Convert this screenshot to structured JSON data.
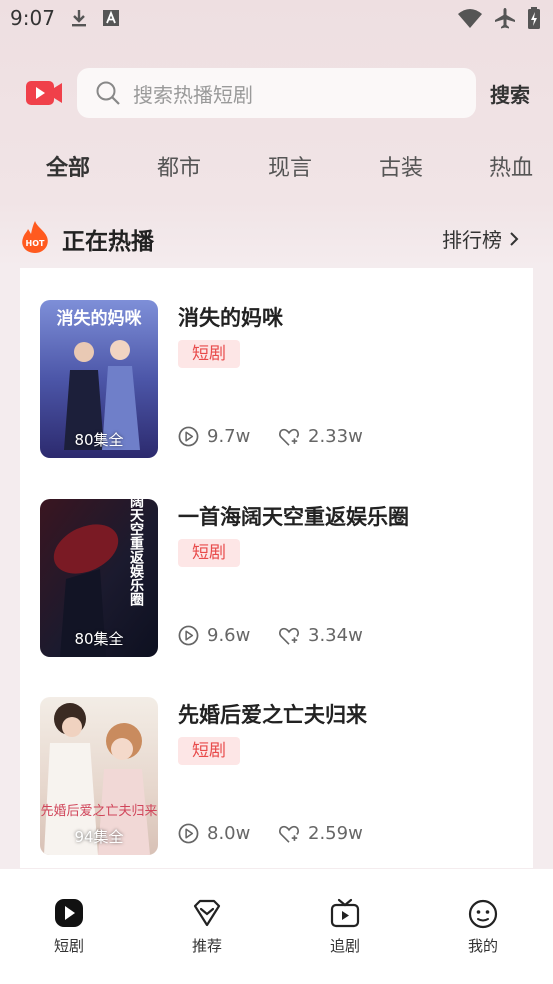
{
  "status_bar": {
    "time": "9:07"
  },
  "header": {
    "search_placeholder": "搜索热播短剧",
    "search_button": "搜索"
  },
  "tabs": [
    {
      "label": "全部",
      "active": true
    },
    {
      "label": "都市",
      "active": false
    },
    {
      "label": "现言",
      "active": false
    },
    {
      "label": "古装",
      "active": false
    },
    {
      "label": "热血",
      "active": false
    }
  ],
  "section": {
    "title": "正在热播",
    "ranking": "排行榜",
    "hot_badge": "HOT"
  },
  "dramas": [
    {
      "title": "消失的妈咪",
      "tag": "短剧",
      "episodes": "80集全",
      "plays": "9.7w",
      "likes": "2.33w",
      "cover_text": "消失的妈咪"
    },
    {
      "title": "一首海阔天空重返娱乐圈",
      "tag": "短剧",
      "episodes": "80集全",
      "plays": "9.6w",
      "likes": "3.34w",
      "cover_text": "一首海阔天空重返娱乐圈"
    },
    {
      "title": "先婚后爱之亡夫归来",
      "tag": "短剧",
      "episodes": "94集全",
      "plays": "8.0w",
      "likes": "2.59w",
      "cover_text": "先婚后爱之亡夫归来"
    }
  ],
  "bottom_nav": [
    {
      "label": "短剧",
      "icon": "play-icon",
      "active": true
    },
    {
      "label": "推荐",
      "icon": "diamond-icon",
      "active": false
    },
    {
      "label": "追剧",
      "icon": "tv-icon",
      "active": false
    },
    {
      "label": "我的",
      "icon": "face-icon",
      "active": false
    }
  ],
  "colors": {
    "accent": "#e84b4b",
    "tag_bg": "#fde6e6",
    "logo": "#f0404a",
    "hot": "#ff5a1f"
  }
}
